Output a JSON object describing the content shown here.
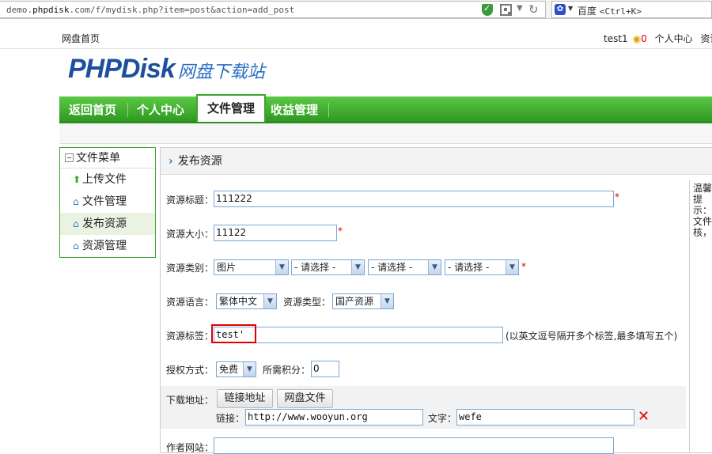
{
  "browser": {
    "url_prefix": "demo.",
    "url_domain": "phpdisk",
    "url_suffix": ".com/f/mydisk.php?item=post&action=add_post",
    "search_engine": "百度",
    "search_hint": "<Ctrl+K>"
  },
  "topbar": {
    "home_link": "网盘首页",
    "username": "test1",
    "coin_icon": "coin-icon",
    "coin_count": "0",
    "user_center": "个人中心",
    "resources": "资讯"
  },
  "logo": {
    "brand": "PHPDisk",
    "tagline": "网盘下载站"
  },
  "nav": {
    "items": [
      "返回首页",
      "个人中心",
      "文件管理",
      "收益管理"
    ],
    "active": "文件管理"
  },
  "sidebar": {
    "title": "文件菜单",
    "items": [
      "上传文件",
      "文件管理",
      "发布资源",
      "资源管理"
    ],
    "active": "发布资源"
  },
  "panel": {
    "title": "发布资源"
  },
  "tip": {
    "text": "温馨提示：文件核，"
  },
  "form": {
    "title_label": "资源标题：",
    "title_value": "111222",
    "size_label": "资源大小：",
    "size_value": "11122",
    "category_label": "资源类别：",
    "category_selects": [
      "图片",
      "- 请选择 -",
      "- 请选择 -",
      "- 请选择 -"
    ],
    "language_label": "资源语言：",
    "language_value": "繁体中文",
    "type_label": "资源类型：",
    "type_value": "国产资源",
    "tags_label": "资源标签：",
    "tags_value": "test'",
    "tags_hint": "(以英文逗号隔开多个标签,最多填写五个)",
    "auth_label": "授权方式：",
    "auth_value": "免费",
    "points_label": "所需积分：",
    "points_value": "0",
    "download_label": "下载地址：",
    "link_button": "链接地址",
    "disk_button": "网盘文件",
    "link_label": "链接：",
    "link_value": "http://www.wooyun.org",
    "text_label": "文字：",
    "text_value": "wefe",
    "author_site_label": "作者网站：",
    "required_mark": "*"
  },
  "colors": {
    "nav_green": "#2f9a22",
    "logo_blue": "#1d4f9e",
    "highlight_red": "#e00000"
  }
}
